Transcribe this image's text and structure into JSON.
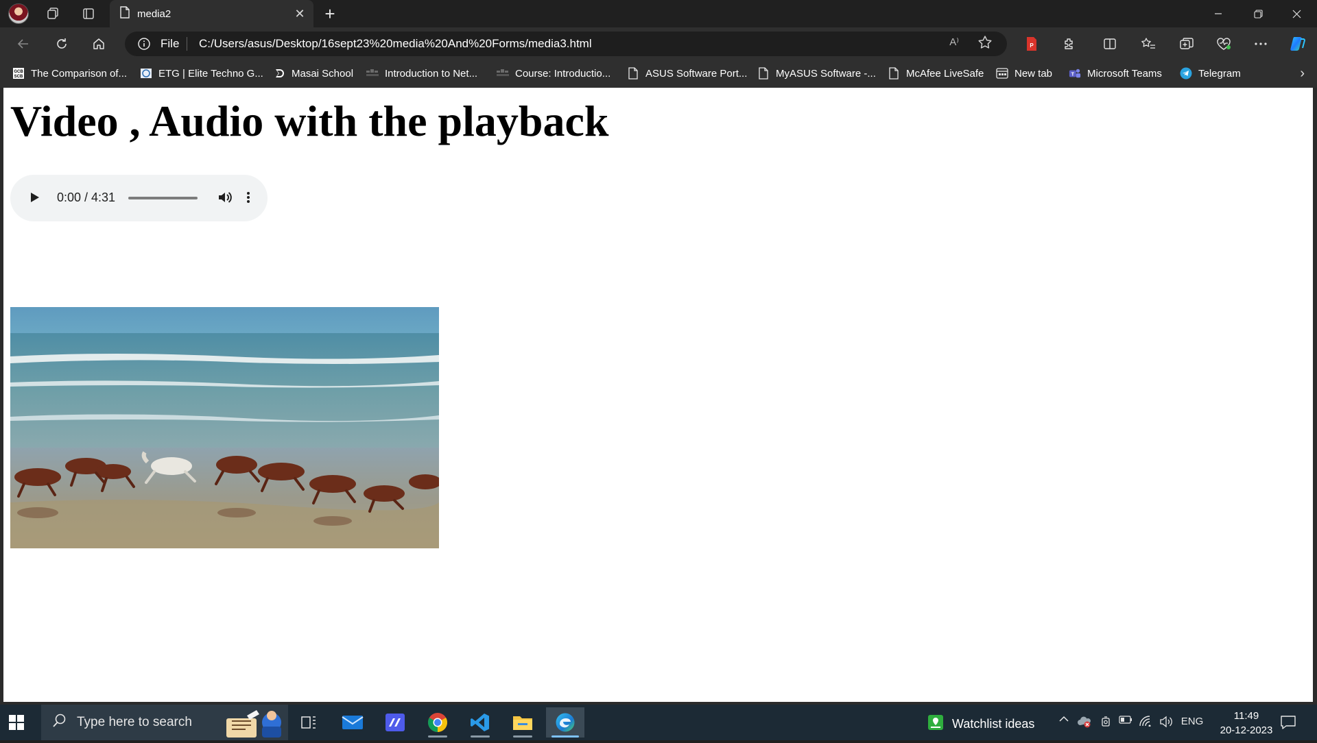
{
  "tab": {
    "title": "media2"
  },
  "address_bar": {
    "scheme_label": "File",
    "url": "C:/Users/asus/Desktop/16sept23%20media%20And%20Forms/media3.html",
    "read_aloud_glyph": "A⁾"
  },
  "bookmarks": [
    {
      "label": "The Comparison of...",
      "icon": "page-icon"
    },
    {
      "label": "ETG | Elite Techno G...",
      "icon": "etg-icon"
    },
    {
      "label": "Masai School",
      "icon": "masai-icon"
    },
    {
      "label": "Introduction to Net...",
      "icon": "course-icon"
    },
    {
      "label": "Course: Introductio...",
      "icon": "course-icon"
    },
    {
      "label": "ASUS Software Port...",
      "icon": "page-icon"
    },
    {
      "label": "MyASUS Software -...",
      "icon": "page-icon"
    },
    {
      "label": "McAfee LiveSafe",
      "icon": "page-icon"
    },
    {
      "label": "New tab",
      "icon": "newtab-icon"
    },
    {
      "label": "Microsoft Teams",
      "icon": "teams-icon"
    },
    {
      "label": "Telegram",
      "icon": "telegram-icon"
    }
  ],
  "page": {
    "heading": "Video , Audio with the playback",
    "audio": {
      "time": "0:00 / 4:31",
      "progress_fraction": 0.0
    },
    "video": {
      "poster": "horses galloping on beach"
    }
  },
  "taskbar": {
    "search_placeholder": "Type here to search",
    "widget_label": "Watchlist ideas",
    "language": "ENG",
    "time": "11:49",
    "date": "20-12-2023"
  },
  "colors": {
    "chrome_dark": "#202020",
    "toolbar": "#2f2f2f",
    "taskbar": "#1c2a35",
    "accent": "#7fc2ff"
  }
}
